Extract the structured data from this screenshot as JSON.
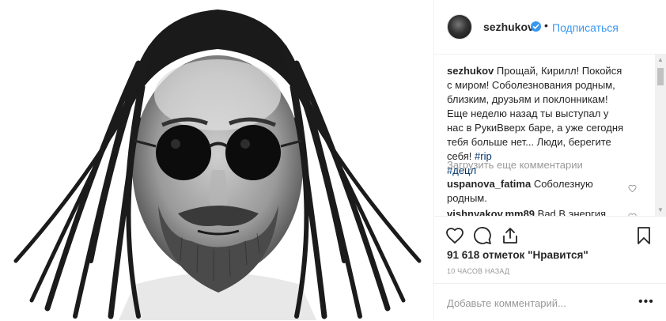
{
  "post": {
    "username": "sezhukov",
    "follow_label": "Подписаться",
    "separator": "•",
    "caption": {
      "username": "sezhukov",
      "text": " Прощай, Кирилл! Покойся с миром! Соболезнования родным, близким, друзьям и поклонникам! Еще неделю назад ты выступал у нас в РукиВверх баре, а уже сегодня тебя больше нет... Люди, берегите себя! ",
      "hashtags": [
        "#rip",
        "#децл"
      ]
    },
    "load_more_label": "Загрузить еще комментарии",
    "comments": [
      {
        "username": "uspanova_fatima",
        "text": " Соболезную родным."
      },
      {
        "username": "vishnyakov.mm89",
        "text": " Bad В энергия"
      }
    ],
    "likes_text": "91 618 отметок \"Нравится\"",
    "time_text": "10 ЧАСОВ НАЗАД",
    "add_comment_placeholder": "Добавьте комментарий...",
    "more_label": "•••"
  },
  "icons": {
    "verified": "verified-badge-icon",
    "like": "heart-icon",
    "comment": "comment-bubble-icon",
    "share": "share-icon",
    "save": "bookmark-icon",
    "comment_like": "small-heart-icon",
    "more": "more-options-icon"
  },
  "colors": {
    "accent": "#3897f0",
    "text": "#262626",
    "muted": "#999999",
    "border": "#efefef"
  }
}
